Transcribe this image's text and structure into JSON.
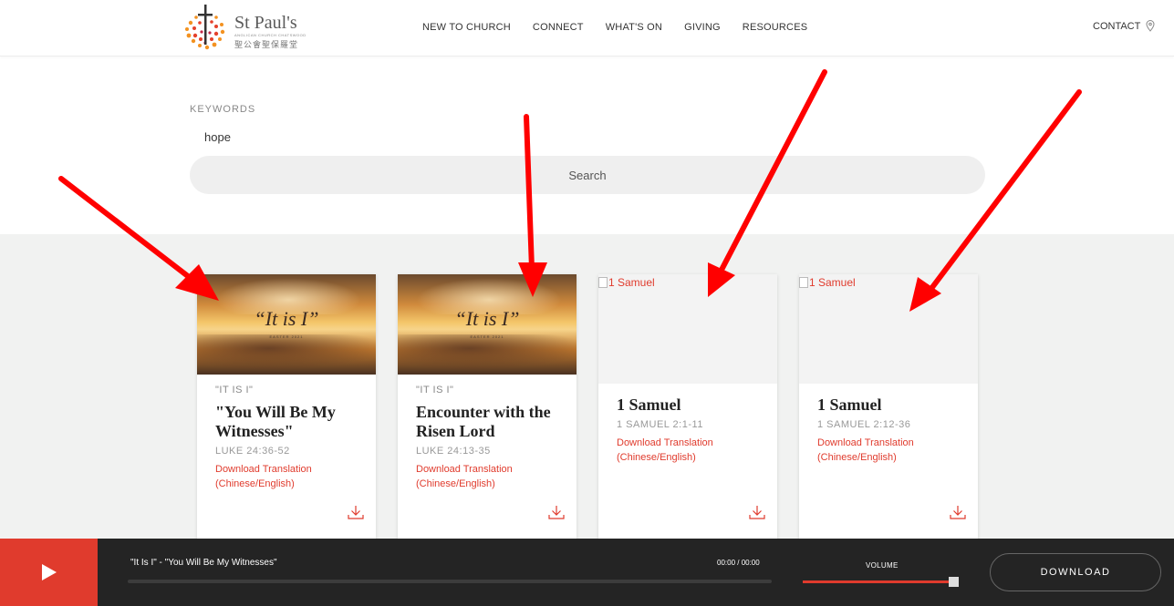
{
  "header": {
    "logo": {
      "title": "St Paul's",
      "subtitle": "ANGLICAN CHURCH CHATSWOOD",
      "chinese": "聖公會聖保羅堂"
    },
    "nav": [
      "NEW TO CHURCH",
      "CONNECT",
      "WHAT'S ON",
      "GIVING",
      "RESOURCES"
    ],
    "contact": "CONTACT"
  },
  "search": {
    "label": "KEYWORDS",
    "value": "hope",
    "button": "Search"
  },
  "cards": [
    {
      "image_title": "“It is I”",
      "image_subtitle": "EASTER 2021",
      "series": "\"IT IS I\"",
      "title": "\"You Will Be My Witnesses\"",
      "passage": "LUKE 24:36-52",
      "link": "Download Translation (Chinese/English)"
    },
    {
      "image_title": "“It is I”",
      "image_subtitle": "EASTER 2021",
      "series": "\"IT IS I\"",
      "title": "Encounter with the Risen Lord",
      "passage": "LUKE 24:13-35",
      "link": "Download Translation (Chinese/English)"
    },
    {
      "image_alt": "1 Samuel",
      "title": "1 Samuel",
      "passage": "1 SAMUEL 2:1-11",
      "link": "Download Translation (Chinese/English)"
    },
    {
      "image_alt": "1 Samuel",
      "title": "1 Samuel",
      "passage": "1 SAMUEL 2:12-36",
      "link": "Download Translation (Chinese/English)"
    }
  ],
  "player": {
    "track": "\"It Is I\" - \"You Will Be My Witnesses\"",
    "time": "00:00 / 00:00",
    "progress": 0,
    "volume_label": "VOLUME",
    "volume": 0.97,
    "download": "DOWNLOAD"
  },
  "colors": {
    "accent": "#e03b2d",
    "player_bg": "#242424",
    "results_bg": "#f1f2f1",
    "annotation_arrow": "#ff0000"
  }
}
